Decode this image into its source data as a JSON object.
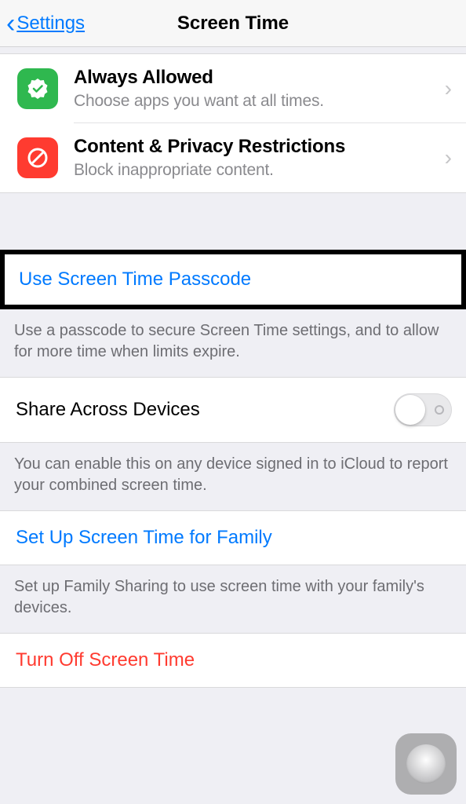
{
  "nav": {
    "back": "Settings",
    "title": "Screen Time"
  },
  "section1": [
    {
      "title": "Always Allowed",
      "subtitle": "Choose apps you want at all times."
    },
    {
      "title": "Content & Privacy Restrictions",
      "subtitle": "Block inappropriate content."
    }
  ],
  "passcode": {
    "label": "Use Screen Time Passcode",
    "footer": "Use a passcode to secure Screen Time settings, and to allow for more time when limits expire."
  },
  "share": {
    "label": "Share Across Devices",
    "footer": "You can enable this on any device signed in to iCloud to report your combined screen time."
  },
  "family": {
    "label": "Set Up Screen Time for Family",
    "footer": "Set up Family Sharing to use screen time with your family's devices."
  },
  "turnoff": {
    "label": "Turn Off Screen Time"
  }
}
